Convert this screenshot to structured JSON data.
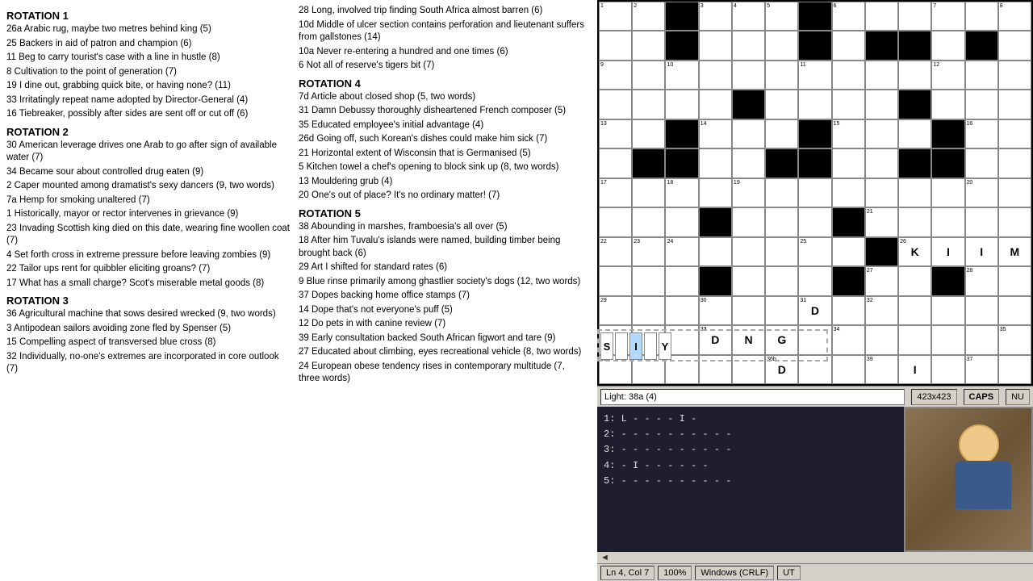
{
  "clues": {
    "col1": [
      {
        "heading": "ROTATION 1",
        "items": [
          {
            "num": "26a",
            "text": "Arabic rug, maybe two metres behind king (5)"
          },
          {
            "num": "25",
            "text": "Backers in aid of patron and champion (6)"
          },
          {
            "num": "11",
            "text": "Beg to carry tourist's case with a line in hustle (8)"
          },
          {
            "num": "8",
            "text": "Cultivation to the point of generation (7)"
          },
          {
            "num": "19",
            "text": "I dine out, grabbing quick bite, or having none? (11)"
          },
          {
            "num": "33",
            "text": "Irritatingly repeat name adopted by Director-General (4)"
          },
          {
            "num": "16",
            "text": "Tiebreaker, possibly after sides are sent off or cut off (6)"
          }
        ]
      },
      {
        "heading": "ROTATION 2",
        "items": [
          {
            "num": "30",
            "text": "American leverage drives one Arab to go after sign of available water (7)"
          },
          {
            "num": "34",
            "text": "Became sour about controlled drug eaten (9)"
          },
          {
            "num": "2",
            "text": "Caper mounted among dramatist's sexy dancers (9, two words)"
          },
          {
            "num": "7a",
            "text": "Hemp for smoking unaltered (7)"
          },
          {
            "num": "1",
            "text": "Historically, mayor or rector intervenes in grievance (9)"
          },
          {
            "num": "23",
            "text": "Invading Scottish king died on this date, wearing fine woollen coat (7)"
          },
          {
            "num": "4",
            "text": "Set forth cross in extreme pressure before leaving zombies (9)"
          },
          {
            "num": "22",
            "text": "Tailor ups rent for quibbler eliciting groans? (7)"
          },
          {
            "num": "17",
            "text": "What has a small charge? Scot's miserable metal goods (8)"
          }
        ]
      },
      {
        "heading": "ROTATION 3",
        "items": [
          {
            "num": "36",
            "text": "Agricultural machine that sows desired wrecked (9, two words)"
          },
          {
            "num": "3",
            "text": "Antipodean sailors avoiding zone fled by Spenser (5)"
          },
          {
            "num": "15",
            "text": "Compelling aspect of transversed blue cross (8)"
          },
          {
            "num": "32",
            "text": "Individually, no-one's extremes are incorporated in core outlook (7)"
          }
        ]
      }
    ],
    "col2": [
      {
        "heading": null,
        "items": [
          {
            "num": "28",
            "text": "Long, involved trip finding South Africa almost barren (6)"
          },
          {
            "num": "10d",
            "text": "Middle of ulcer section contains perforation and lieutenant suffers from gallstones (14)"
          },
          {
            "num": "10a",
            "text": "Never re-entering a hundred and one times (6)"
          },
          {
            "num": "6",
            "text": "Not all of reserve's tigers bit (7)"
          }
        ]
      },
      {
        "heading": "ROTATION 4",
        "items": [
          {
            "num": "7d",
            "text": "Article about closed shop (5, two words)"
          },
          {
            "num": "31",
            "text": "Damn Debussy thoroughly disheartened French composer (5)"
          },
          {
            "num": "35",
            "text": "Educated employee's initial advantage (4)"
          },
          {
            "num": "26d",
            "text": "Going off, such Korean's dishes could make him sick (7)"
          },
          {
            "num": "21",
            "text": "Horizontal extent of Wisconsin that is Germanised (5)"
          },
          {
            "num": "5",
            "text": "Kitchen towel a chef's opening to block sink up (8, two words)"
          },
          {
            "num": "13",
            "text": "Mouldering grub (4)"
          },
          {
            "num": "20",
            "text": "One's out of place? It's no ordinary matter! (7)"
          }
        ]
      },
      {
        "heading": "ROTATION 5",
        "items": [
          {
            "num": "38",
            "text": "Abounding in marshes, framboesia's all over (5)"
          },
          {
            "num": "18",
            "text": "After him Tuvalu's islands were named, building timber being brought back (6)"
          },
          {
            "num": "29",
            "text": "Art I shifted for standard rates (6)"
          },
          {
            "num": "9",
            "text": "Blue rinse primarily among ghastlier society's dogs (12, two words)"
          },
          {
            "num": "37",
            "text": "Dopes backing home office stamps (7)"
          },
          {
            "num": "14",
            "text": "Dope that's not everyone's puff (5)"
          },
          {
            "num": "12",
            "text": "Do pets in with canine review (7)"
          },
          {
            "num": "39",
            "text": "Early consultation backed South African figwort and tare (9)"
          },
          {
            "num": "27",
            "text": "Educated about climbing, eyes recreational vehicle (8, two words)"
          },
          {
            "num": "24",
            "text": "European obese tendency rises in contemporary multitude (7, three words)"
          }
        ]
      }
    ]
  },
  "grid": {
    "rows": 13,
    "cols": 13,
    "cells": [
      [
        {
          "black": false,
          "num": "1"
        },
        {
          "black": false,
          "num": "2"
        },
        {
          "black": true
        },
        {
          "black": false,
          "num": "3"
        },
        {
          "black": false,
          "num": "4"
        },
        {
          "black": false,
          "num": "5"
        },
        {
          "black": true
        },
        {
          "black": false,
          "num": "6"
        },
        {
          "black": false
        },
        {
          "black": false
        },
        {
          "black": false,
          "num": "7"
        },
        {
          "black": false
        },
        {
          "black": false,
          "num": "8"
        }
      ],
      [
        {
          "black": false
        },
        {
          "black": false
        },
        {
          "black": true
        },
        {
          "black": false
        },
        {
          "black": false
        },
        {
          "black": false
        },
        {
          "black": true
        },
        {
          "black": false
        },
        {
          "black": true
        },
        {
          "black": true
        },
        {
          "black": false
        },
        {
          "black": true
        },
        {
          "black": false
        }
      ],
      [
        {
          "black": false,
          "num": "9"
        },
        {
          "black": false
        },
        {
          "black": false,
          "num": "10"
        },
        {
          "black": false
        },
        {
          "black": false
        },
        {
          "black": false
        },
        {
          "black": false,
          "num": "11"
        },
        {
          "black": false
        },
        {
          "black": false
        },
        {
          "black": false
        },
        {
          "black": false,
          "num": "12"
        },
        {
          "black": false
        },
        {
          "black": false
        }
      ],
      [
        {
          "black": false
        },
        {
          "black": false
        },
        {
          "black": false
        },
        {
          "black": false
        },
        {
          "black": true
        },
        {
          "black": false
        },
        {
          "black": false
        },
        {
          "black": false
        },
        {
          "black": false
        },
        {
          "black": true
        },
        {
          "black": false
        },
        {
          "black": false
        },
        {
          "black": false
        }
      ],
      [
        {
          "black": false,
          "num": "13"
        },
        {
          "black": false
        },
        {
          "black": true
        },
        {
          "black": false,
          "num": "14"
        },
        {
          "black": false
        },
        {
          "black": false
        },
        {
          "black": true
        },
        {
          "black": false,
          "num": "15"
        },
        {
          "black": false
        },
        {
          "black": false
        },
        {
          "black": true
        },
        {
          "black": false,
          "num": "16"
        },
        {
          "black": false
        }
      ],
      [
        {
          "black": false
        },
        {
          "black": true
        },
        {
          "black": true
        },
        {
          "black": false
        },
        {
          "black": false
        },
        {
          "black": true
        },
        {
          "black": true
        },
        {
          "black": false
        },
        {
          "black": false
        },
        {
          "black": true
        },
        {
          "black": true
        },
        {
          "black": false
        },
        {
          "black": false
        }
      ],
      [
        {
          "black": false,
          "num": "17"
        },
        {
          "black": false
        },
        {
          "black": false,
          "num": "18"
        },
        {
          "black": false
        },
        {
          "black": false,
          "num": "19"
        },
        {
          "black": false
        },
        {
          "black": false
        },
        {
          "black": false
        },
        {
          "black": false
        },
        {
          "black": false
        },
        {
          "black": false
        },
        {
          "black": false,
          "num": "20"
        },
        {
          "black": false
        }
      ],
      [
        {
          "black": false
        },
        {
          "black": false
        },
        {
          "black": false
        },
        {
          "black": true
        },
        {
          "black": false
        },
        {
          "black": false
        },
        {
          "black": false
        },
        {
          "black": true
        },
        {
          "black": false,
          "num": "21"
        },
        {
          "black": false
        },
        {
          "black": false
        },
        {
          "black": false
        },
        {
          "black": false
        }
      ],
      [
        {
          "black": false,
          "num": "22"
        },
        {
          "black": false,
          "num": "23"
        },
        {
          "black": false,
          "num": "24"
        },
        {
          "black": false
        },
        {
          "black": false
        },
        {
          "black": false
        },
        {
          "black": false,
          "num": "25"
        },
        {
          "black": false
        },
        {
          "black": true
        },
        {
          "black": false,
          "num": "26",
          "letter": "K"
        },
        {
          "black": false,
          "letter": "I"
        },
        {
          "black": false,
          "letter": "I"
        },
        {
          "black": false,
          "letter": "M"
        }
      ],
      [
        {
          "black": false
        },
        {
          "black": false
        },
        {
          "black": false
        },
        {
          "black": true
        },
        {
          "black": false
        },
        {
          "black": false
        },
        {
          "black": false
        },
        {
          "black": true
        },
        {
          "black": false,
          "num": "27"
        },
        {
          "black": false
        },
        {
          "black": true
        },
        {
          "black": false,
          "num": "28"
        },
        {
          "black": false
        }
      ],
      [
        {
          "black": false,
          "num": "29"
        },
        {
          "black": false
        },
        {
          "black": false
        },
        {
          "black": false,
          "num": "30"
        },
        {
          "black": false
        },
        {
          "black": false
        },
        {
          "black": false,
          "num": "31",
          "letter": "D"
        },
        {
          "black": false
        },
        {
          "black": false,
          "num": "32"
        },
        {
          "black": false
        },
        {
          "black": false
        },
        {
          "black": false
        },
        {
          "black": false
        }
      ],
      [
        {
          "black": false
        },
        {
          "black": false
        },
        {
          "black": false
        },
        {
          "black": false
        },
        {
          "black": false
        },
        {
          "black": false
        },
        {
          "black": false
        },
        {
          "black": false
        },
        {
          "black": false
        },
        {
          "black": false
        },
        {
          "black": false
        },
        {
          "black": false
        },
        {
          "black": false,
          "num": "33"
        }
      ],
      [
        {
          "black": false
        },
        {
          "black": false
        },
        {
          "black": false
        },
        {
          "black": false
        },
        {
          "black": false
        },
        {
          "black": false
        },
        {
          "black": false
        },
        {
          "black": false
        },
        {
          "black": false
        },
        {
          "black": false
        },
        {
          "black": false
        },
        {
          "black": false
        },
        {
          "black": false
        }
      ]
    ],
    "special_cells": {
      "D_positions": [
        {
          "row": 10,
          "col": 6,
          "letter": "D"
        },
        {
          "row": 11,
          "col": 3,
          "letter": "D"
        },
        {
          "row": 11,
          "col": 4,
          "letter": "N"
        },
        {
          "row": 11,
          "col": 5,
          "letter": "G"
        },
        {
          "row": 12,
          "col": 6,
          "letter": "D"
        },
        {
          "row": 12,
          "col": 8,
          "letter": "I"
        },
        {
          "row": 12,
          "col": 0,
          "letter": "S"
        },
        {
          "row": 12,
          "col": 2,
          "letter": "I"
        },
        {
          "row": 12,
          "col": 8,
          "letter": "Y"
        }
      ]
    }
  },
  "grid_visual": {
    "rows": [
      [
        0,
        0,
        1,
        0,
        0,
        0,
        1,
        0,
        0,
        0,
        0,
        0,
        0
      ],
      [
        0,
        0,
        1,
        0,
        0,
        0,
        1,
        0,
        1,
        1,
        0,
        1,
        0
      ],
      [
        0,
        0,
        0,
        0,
        0,
        0,
        0,
        0,
        0,
        0,
        0,
        0,
        0
      ],
      [
        0,
        0,
        0,
        0,
        1,
        0,
        0,
        0,
        0,
        1,
        0,
        0,
        0
      ],
      [
        0,
        0,
        1,
        0,
        0,
        0,
        1,
        0,
        0,
        0,
        1,
        0,
        0
      ],
      [
        0,
        1,
        1,
        0,
        0,
        1,
        1,
        0,
        0,
        1,
        1,
        0,
        0
      ],
      [
        0,
        0,
        0,
        0,
        0,
        0,
        0,
        0,
        0,
        0,
        0,
        0,
        0
      ],
      [
        0,
        0,
        0,
        1,
        0,
        0,
        0,
        1,
        0,
        0,
        0,
        0,
        0
      ],
      [
        0,
        0,
        0,
        0,
        0,
        0,
        0,
        0,
        1,
        0,
        0,
        0,
        0
      ],
      [
        0,
        0,
        0,
        1,
        0,
        0,
        0,
        1,
        0,
        0,
        1,
        0,
        0
      ],
      [
        0,
        0,
        0,
        0,
        0,
        0,
        0,
        0,
        0,
        0,
        0,
        0,
        0
      ],
      [
        0,
        0,
        0,
        0,
        0,
        0,
        0,
        0,
        0,
        0,
        0,
        0,
        0
      ],
      [
        0,
        0,
        0,
        0,
        0,
        0,
        0,
        0,
        0,
        0,
        0,
        0,
        0
      ]
    ]
  },
  "status_bar": {
    "clue_label": "Light: 38a (4)",
    "coords": "423x423",
    "caps": "CAPS",
    "num": "NU"
  },
  "letter_hints": {
    "lines": [
      "1:  L - - - - I -",
      "2:  - - - - - - - - - -",
      "3:  - - - - - - - - - -",
      "4:  - I - - - - - -",
      "5:  - - - - - - - - - -"
    ]
  },
  "editor_status": {
    "line": "Ln 4, Col 7",
    "zoom": "100%",
    "line_ending": "Windows (CRLF)",
    "encoding": "UT"
  },
  "scroll_arrow": "◄"
}
